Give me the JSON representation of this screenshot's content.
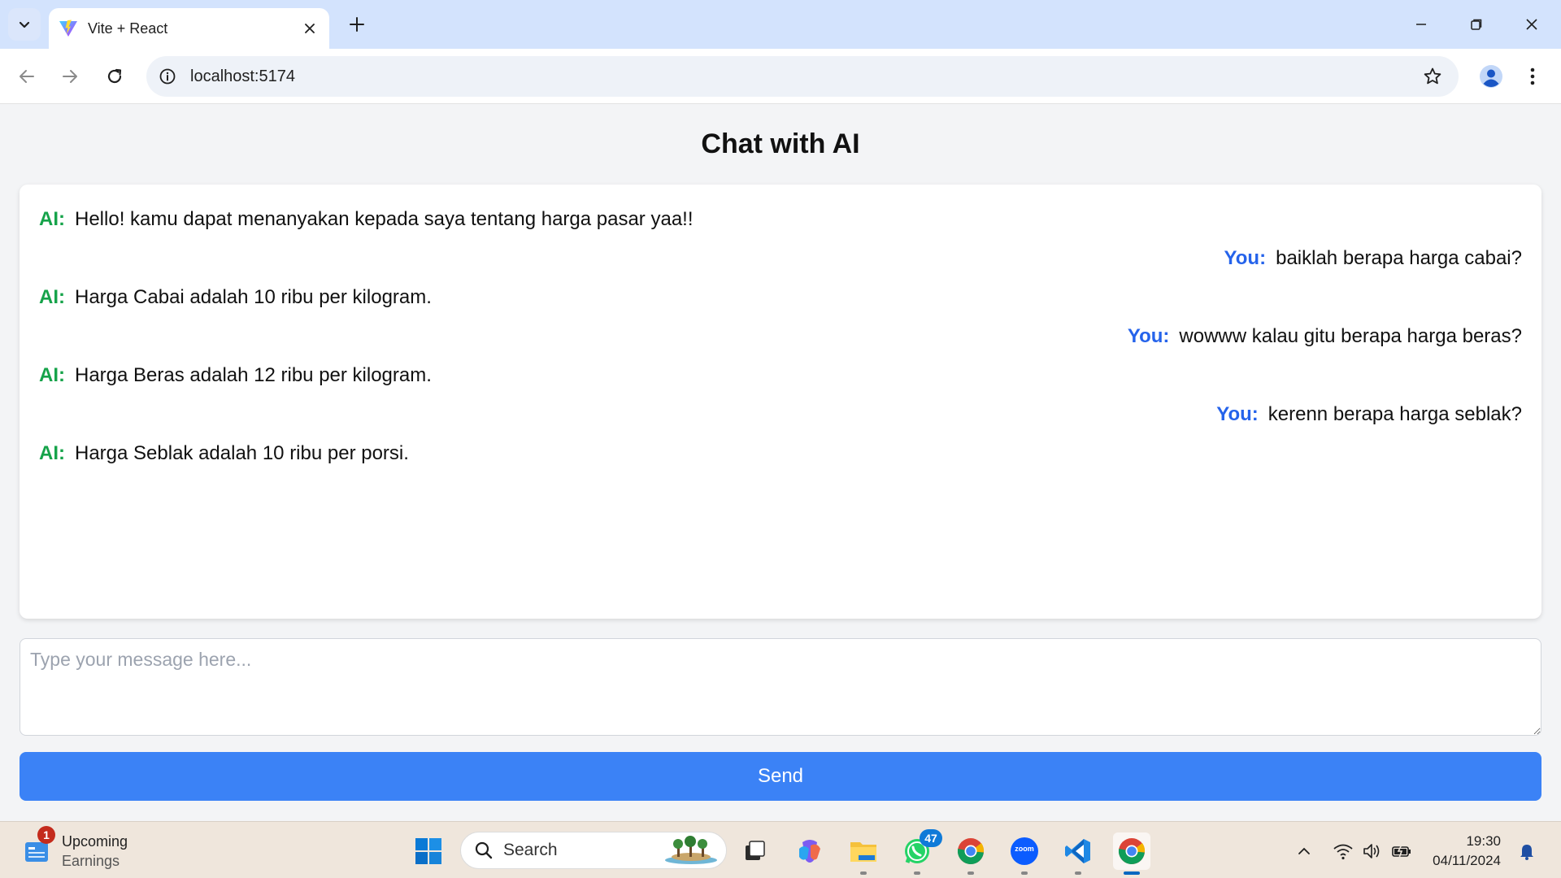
{
  "browser": {
    "tab_title": "Vite + React",
    "url": "localhost:5174"
  },
  "page": {
    "title": "Chat with AI"
  },
  "chat": {
    "messages": [
      {
        "sender": "AI",
        "label": "AI:",
        "text": "Hello! kamu dapat menanyakan kepada saya tentang harga pasar yaa!!"
      },
      {
        "sender": "You",
        "label": "You:",
        "text": "baiklah berapa harga cabai?"
      },
      {
        "sender": "AI",
        "label": "AI:",
        "text": "Harga Cabai adalah 10 ribu per kilogram."
      },
      {
        "sender": "You",
        "label": "You:",
        "text": "wowww kalau gitu berapa harga beras?"
      },
      {
        "sender": "AI",
        "label": "AI:",
        "text": "Harga Beras adalah 12 ribu per kilogram."
      },
      {
        "sender": "You",
        "label": "You:",
        "text": "kerenn berapa harga seblak?"
      },
      {
        "sender": "AI",
        "label": "AI:",
        "text": "Harga Seblak adalah 10 ribu per porsi."
      }
    ],
    "colors": {
      "ai_label": "#16a34a",
      "user_label": "#2563eb"
    }
  },
  "composer": {
    "placeholder": "Type your message here...",
    "value": "",
    "send_label": "Send",
    "send_color": "#3b82f6"
  },
  "taskbar": {
    "widget": {
      "title": "Upcoming",
      "subtitle": "Earnings",
      "badge": "1"
    },
    "search_label": "Search",
    "whatsapp_badge": "47",
    "zoom_label": "zoom",
    "time": "19:30",
    "date": "04/11/2024",
    "apps": [
      "windows-start-icon",
      "search-icon",
      "task-view-icon",
      "copilot-icon",
      "file-explorer-icon",
      "whatsapp-icon",
      "chrome-icon",
      "zoom-icon",
      "vscode-icon",
      "chrome-icon"
    ]
  }
}
